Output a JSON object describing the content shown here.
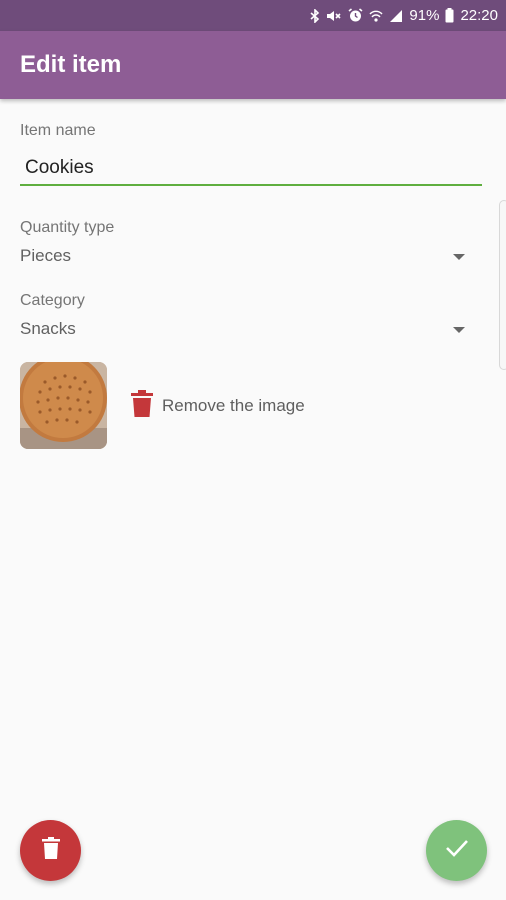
{
  "status_bar": {
    "battery_percent": "91%",
    "time": "22:20",
    "icons": [
      "bluetooth-icon",
      "mute-icon",
      "alarm-icon",
      "wifi-icon",
      "signal-icon",
      "battery-icon"
    ]
  },
  "app_bar": {
    "title": "Edit item"
  },
  "form": {
    "item_name": {
      "label": "Item name",
      "value": "Cookies"
    },
    "quantity_type": {
      "label": "Quantity type",
      "selected": "Pieces"
    },
    "category": {
      "label": "Category",
      "selected": "Snacks"
    },
    "image": {
      "thumbnail_icon": "cookie-photo",
      "remove_label": "Remove the image"
    }
  },
  "fabs": {
    "delete_icon": "trash-icon",
    "confirm_icon": "check-icon"
  },
  "colors": {
    "status_bar": "#6f4c7b",
    "app_bar": "#8e5d95",
    "input_underline": "#5fae3f",
    "delete": "#c4373a",
    "confirm": "#7fc27c"
  }
}
